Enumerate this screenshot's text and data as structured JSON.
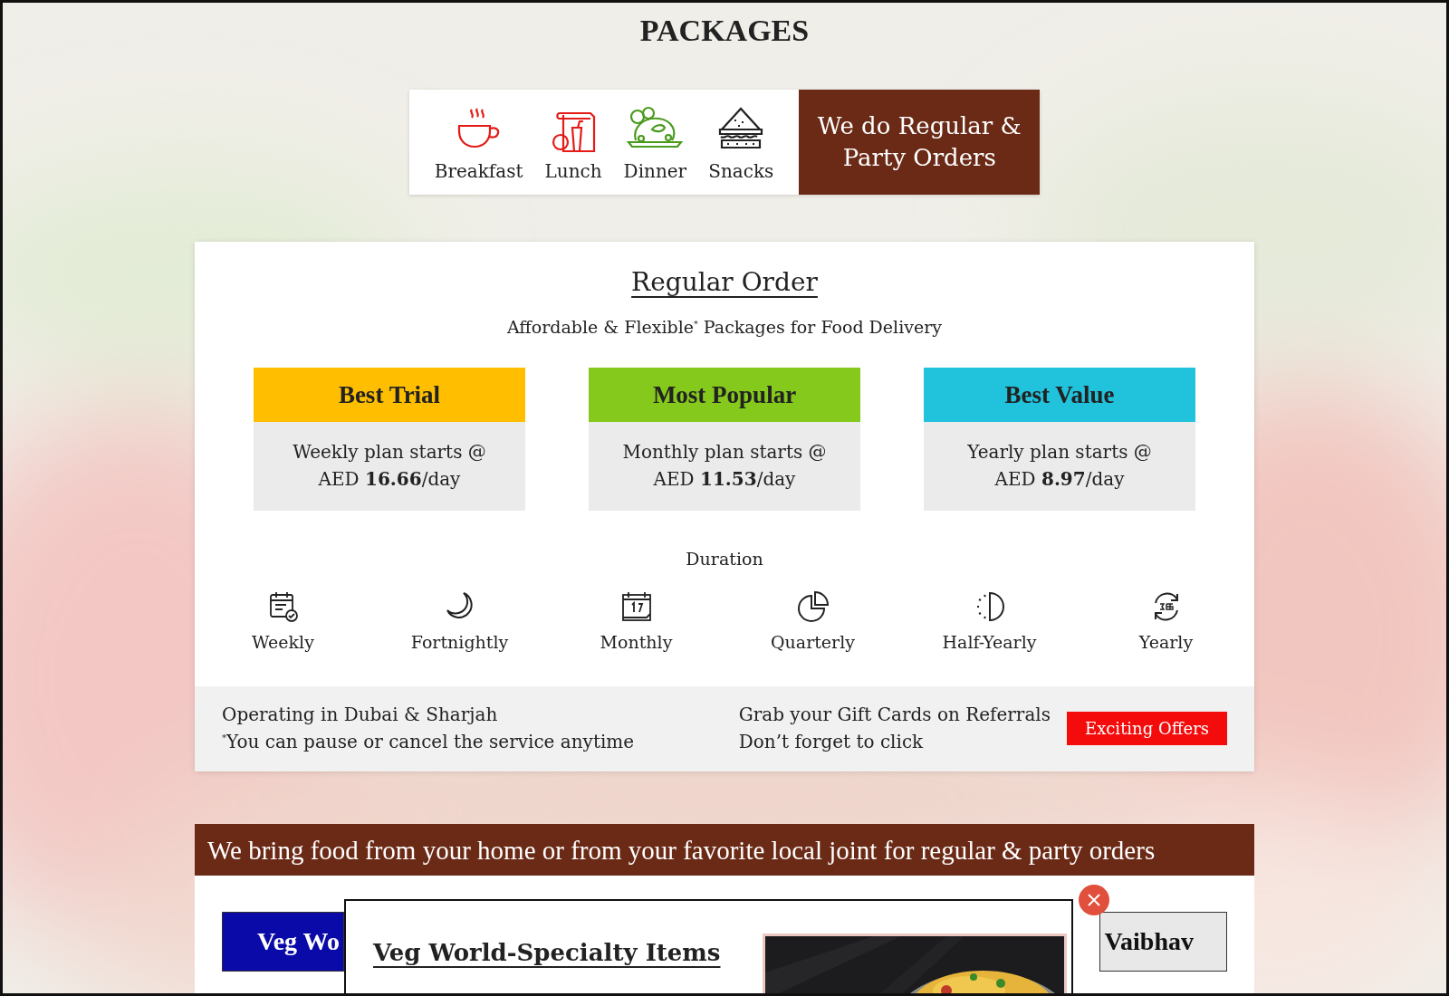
{
  "title": "PACKAGES",
  "categories": [
    {
      "label": "Breakfast",
      "kind": "cup"
    },
    {
      "label": "Lunch",
      "kind": "lunch"
    },
    {
      "label": "Dinner",
      "kind": "dinner"
    },
    {
      "label": "Snacks",
      "kind": "sandwich"
    }
  ],
  "orders_button": "We do Regular & Party Orders",
  "regular_order": {
    "heading": "Regular Order",
    "subtitle": "Affordable & Flexible$^{*}$ Packages for Food Delivery",
    "plans": [
      {
        "badge": "Best Trial",
        "color": "#ffbf00",
        "line": "Weekly plan starts @",
        "price": "AED **16.66**/day"
      },
      {
        "badge": "Most Popular",
        "color": "#84c91c",
        "line": "Monthly plan starts @",
        "price": "AED **11.53**/day"
      },
      {
        "badge": "Best Value",
        "color": "#21c3dc",
        "line": "Yearly plan starts @",
        "price": "AED **8.97**/day"
      }
    ],
    "duration_label": "Duration",
    "durations": [
      {
        "label": "Weekly",
        "kind": "calendar-check"
      },
      {
        "label": "Fortnightly",
        "kind": "moon"
      },
      {
        "label": "Monthly",
        "kind": "calendar"
      },
      {
        "label": "Quarterly",
        "kind": "pie"
      },
      {
        "label": "Half-Yearly",
        "kind": "half"
      },
      {
        "label": "Yearly",
        "kind": "cycle"
      }
    ],
    "footer": {
      "left": [
        "Operating in Dubai & Sharjah",
        "$^{*}$You can pause or cancel the service anytime"
      ],
      "right": [
        "Grab your Gift Cards on Referrals",
        "Don’t forget to click"
      ],
      "offers_button": "Exciting Offers"
    }
  },
  "banner": "We bring food from your home or from your favorite local joint for regular & party orders",
  "tabs": [
    {
      "label": "Veg Wo",
      "selected": true
    },
    {
      "label": "Vaibhav",
      "selected": false
    }
  ],
  "popup": {
    "title": "Veg World-Specialty Items"
  }
}
